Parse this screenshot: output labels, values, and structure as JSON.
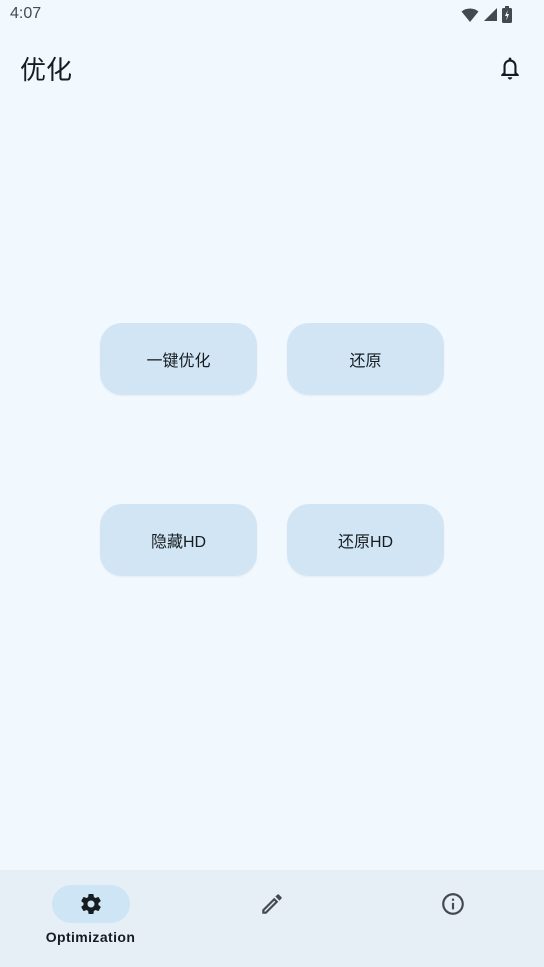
{
  "status_bar": {
    "time": "4:07",
    "icons": [
      "wifi-icon",
      "cell-signal-icon",
      "battery-icon"
    ]
  },
  "app_bar": {
    "title": "优化",
    "action_icon": "bell-icon"
  },
  "actions": {
    "one_click_optimize": "一键优化",
    "restore": "还原",
    "hide_hd": "隐藏HD",
    "restore_hd": "还原HD"
  },
  "bottom_nav": {
    "items": [
      {
        "label": "Optimization",
        "icon": "gear-icon",
        "active": true
      },
      {
        "label": "",
        "icon": "pencil-icon",
        "active": false
      },
      {
        "label": "",
        "icon": "info-icon",
        "active": false
      }
    ]
  },
  "colors": {
    "background": "#f2f9fe",
    "button": "#d2e5f4",
    "nav_bar": "#e7eff6",
    "nav_indicator": "#cde5f5",
    "text": "#161c20"
  }
}
